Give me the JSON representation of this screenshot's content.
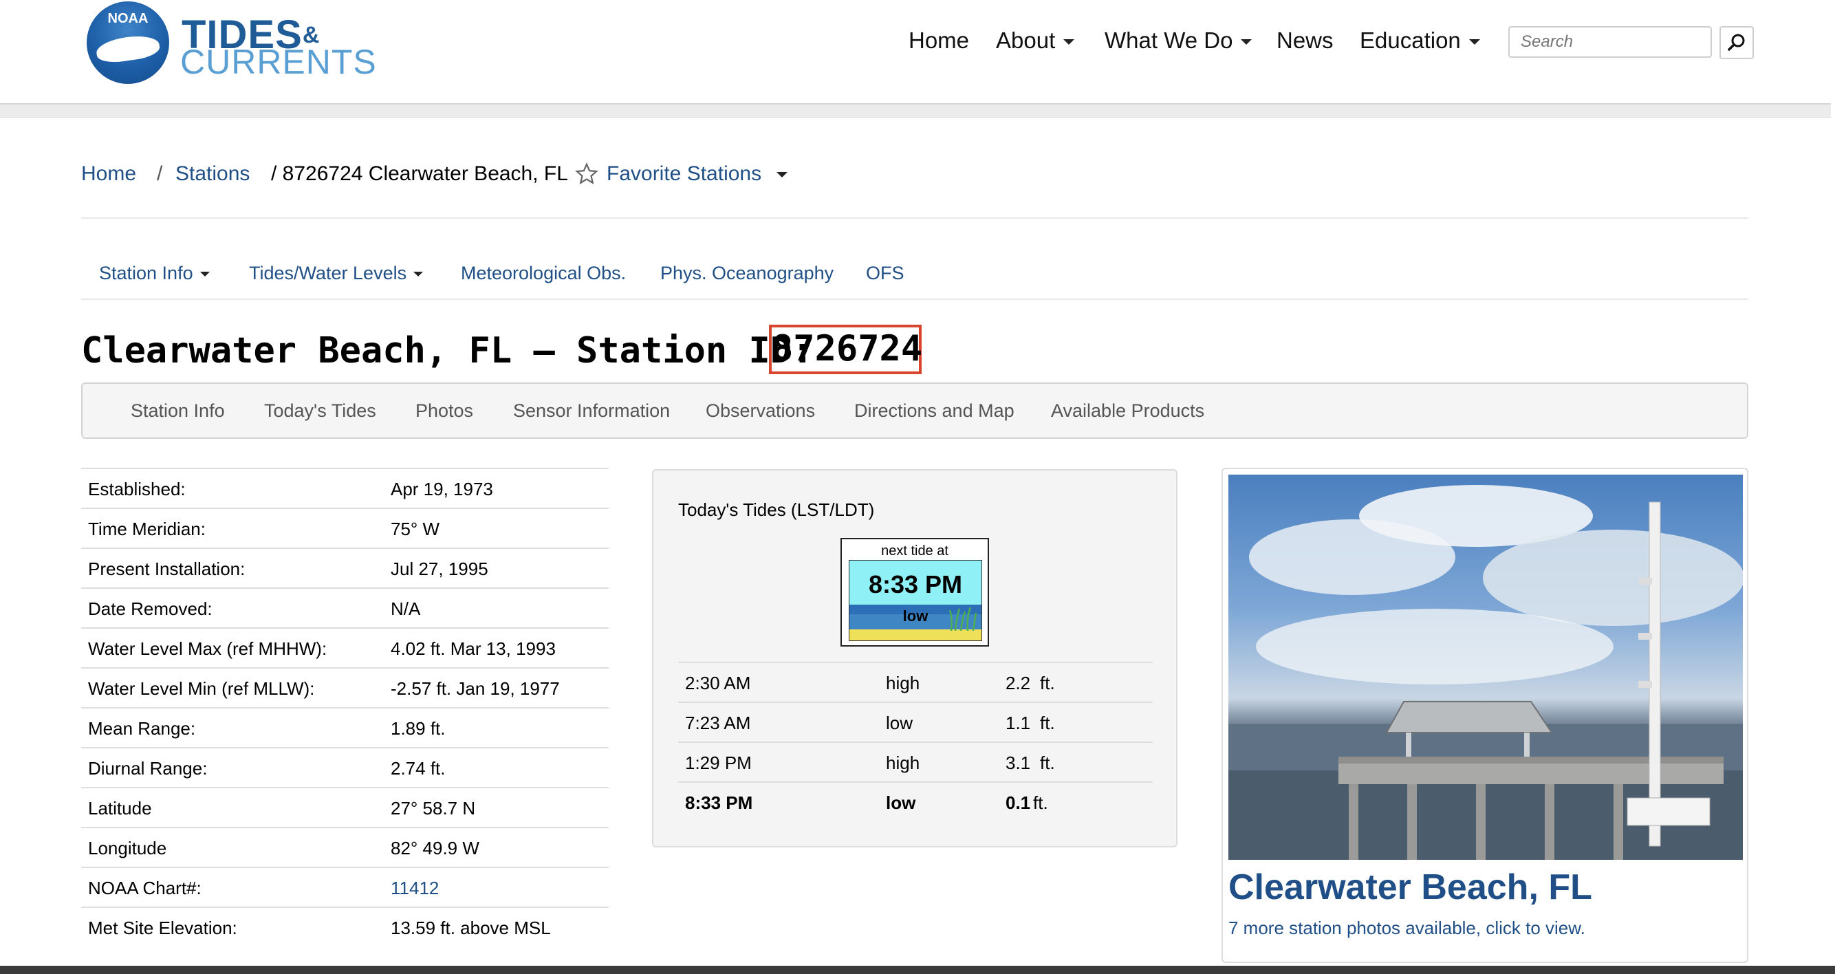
{
  "header": {
    "logo": {
      "noaa": "NOAA",
      "line1": "TIDES",
      "amp": "&",
      "line2": "CURRENTS"
    },
    "nav": [
      {
        "label": "Home",
        "dropdown": false
      },
      {
        "label": "About",
        "dropdown": true
      },
      {
        "label": "What We Do",
        "dropdown": true
      },
      {
        "label": "News",
        "dropdown": false
      },
      {
        "label": "Education",
        "dropdown": true
      }
    ],
    "search": {
      "placeholder": "Search"
    }
  },
  "breadcrumb": {
    "home": "Home",
    "sep": "/",
    "stations": "Stations",
    "current": "/ 8726724 Clearwater Beach, FL",
    "favorites": "Favorite Stations"
  },
  "station_nav": [
    {
      "label": "Station Info",
      "dropdown": true
    },
    {
      "label": "Tides/Water Levels",
      "dropdown": true
    },
    {
      "label": "Meteorological Obs.",
      "dropdown": false
    },
    {
      "label": "Phys. Oceanography",
      "dropdown": false
    },
    {
      "label": "OFS",
      "dropdown": false
    }
  ],
  "title": {
    "prefix": "Clearwater Beach, FL – Station ID:",
    "station_id": "8726724"
  },
  "tabs": [
    "Station Info",
    "Today's Tides",
    "Photos",
    "Sensor Information",
    "Observations",
    "Directions and Map",
    "Available Products"
  ],
  "station_info": [
    {
      "label": "Established:",
      "value": "Apr 19, 1973"
    },
    {
      "label": "Time Meridian:",
      "value": "75° W"
    },
    {
      "label": "Present Installation:",
      "value": "Jul 27, 1995"
    },
    {
      "label": "Date Removed:",
      "value": "N/A"
    },
    {
      "label": "Water Level Max (ref MHHW):",
      "value": "4.02 ft. Mar 13, 1993"
    },
    {
      "label": "Water Level Min (ref MLLW):",
      "value": "-2.57 ft. Jan 19, 1977"
    },
    {
      "label": "Mean Range:",
      "value": "1.89 ft."
    },
    {
      "label": "Diurnal Range:",
      "value": "2.74 ft."
    },
    {
      "label": "Latitude",
      "value": "27° 58.7 N"
    },
    {
      "label": "Longitude",
      "value": "82° 49.9 W"
    },
    {
      "label": "NOAA Chart#:",
      "value": "11412"
    },
    {
      "label": "Met Site Elevation:",
      "value": "13.59 ft. above MSL"
    }
  ],
  "todays_tides": {
    "heading": "Today's Tides (LST/LDT)",
    "next_tide": {
      "label": "next tide at",
      "time": "8:33 PM",
      "type": "low"
    },
    "rows": [
      {
        "time": "2:30 AM",
        "type": "high",
        "height": "2.2",
        "unit": "ft."
      },
      {
        "time": "7:23 AM",
        "type": "low",
        "height": "1.1",
        "unit": "ft."
      },
      {
        "time": "1:29 PM",
        "type": "high",
        "height": "3.1",
        "unit": "ft."
      },
      {
        "time": "8:33 PM",
        "type": "low",
        "height": "0.1",
        "unit": "ft."
      }
    ]
  },
  "photo_card": {
    "name": "Clearwater Beach, FL",
    "more": "7 more station photos available, click to view."
  },
  "colors": {
    "link": "#1f4f86",
    "highlight_box": "#d9462f"
  }
}
